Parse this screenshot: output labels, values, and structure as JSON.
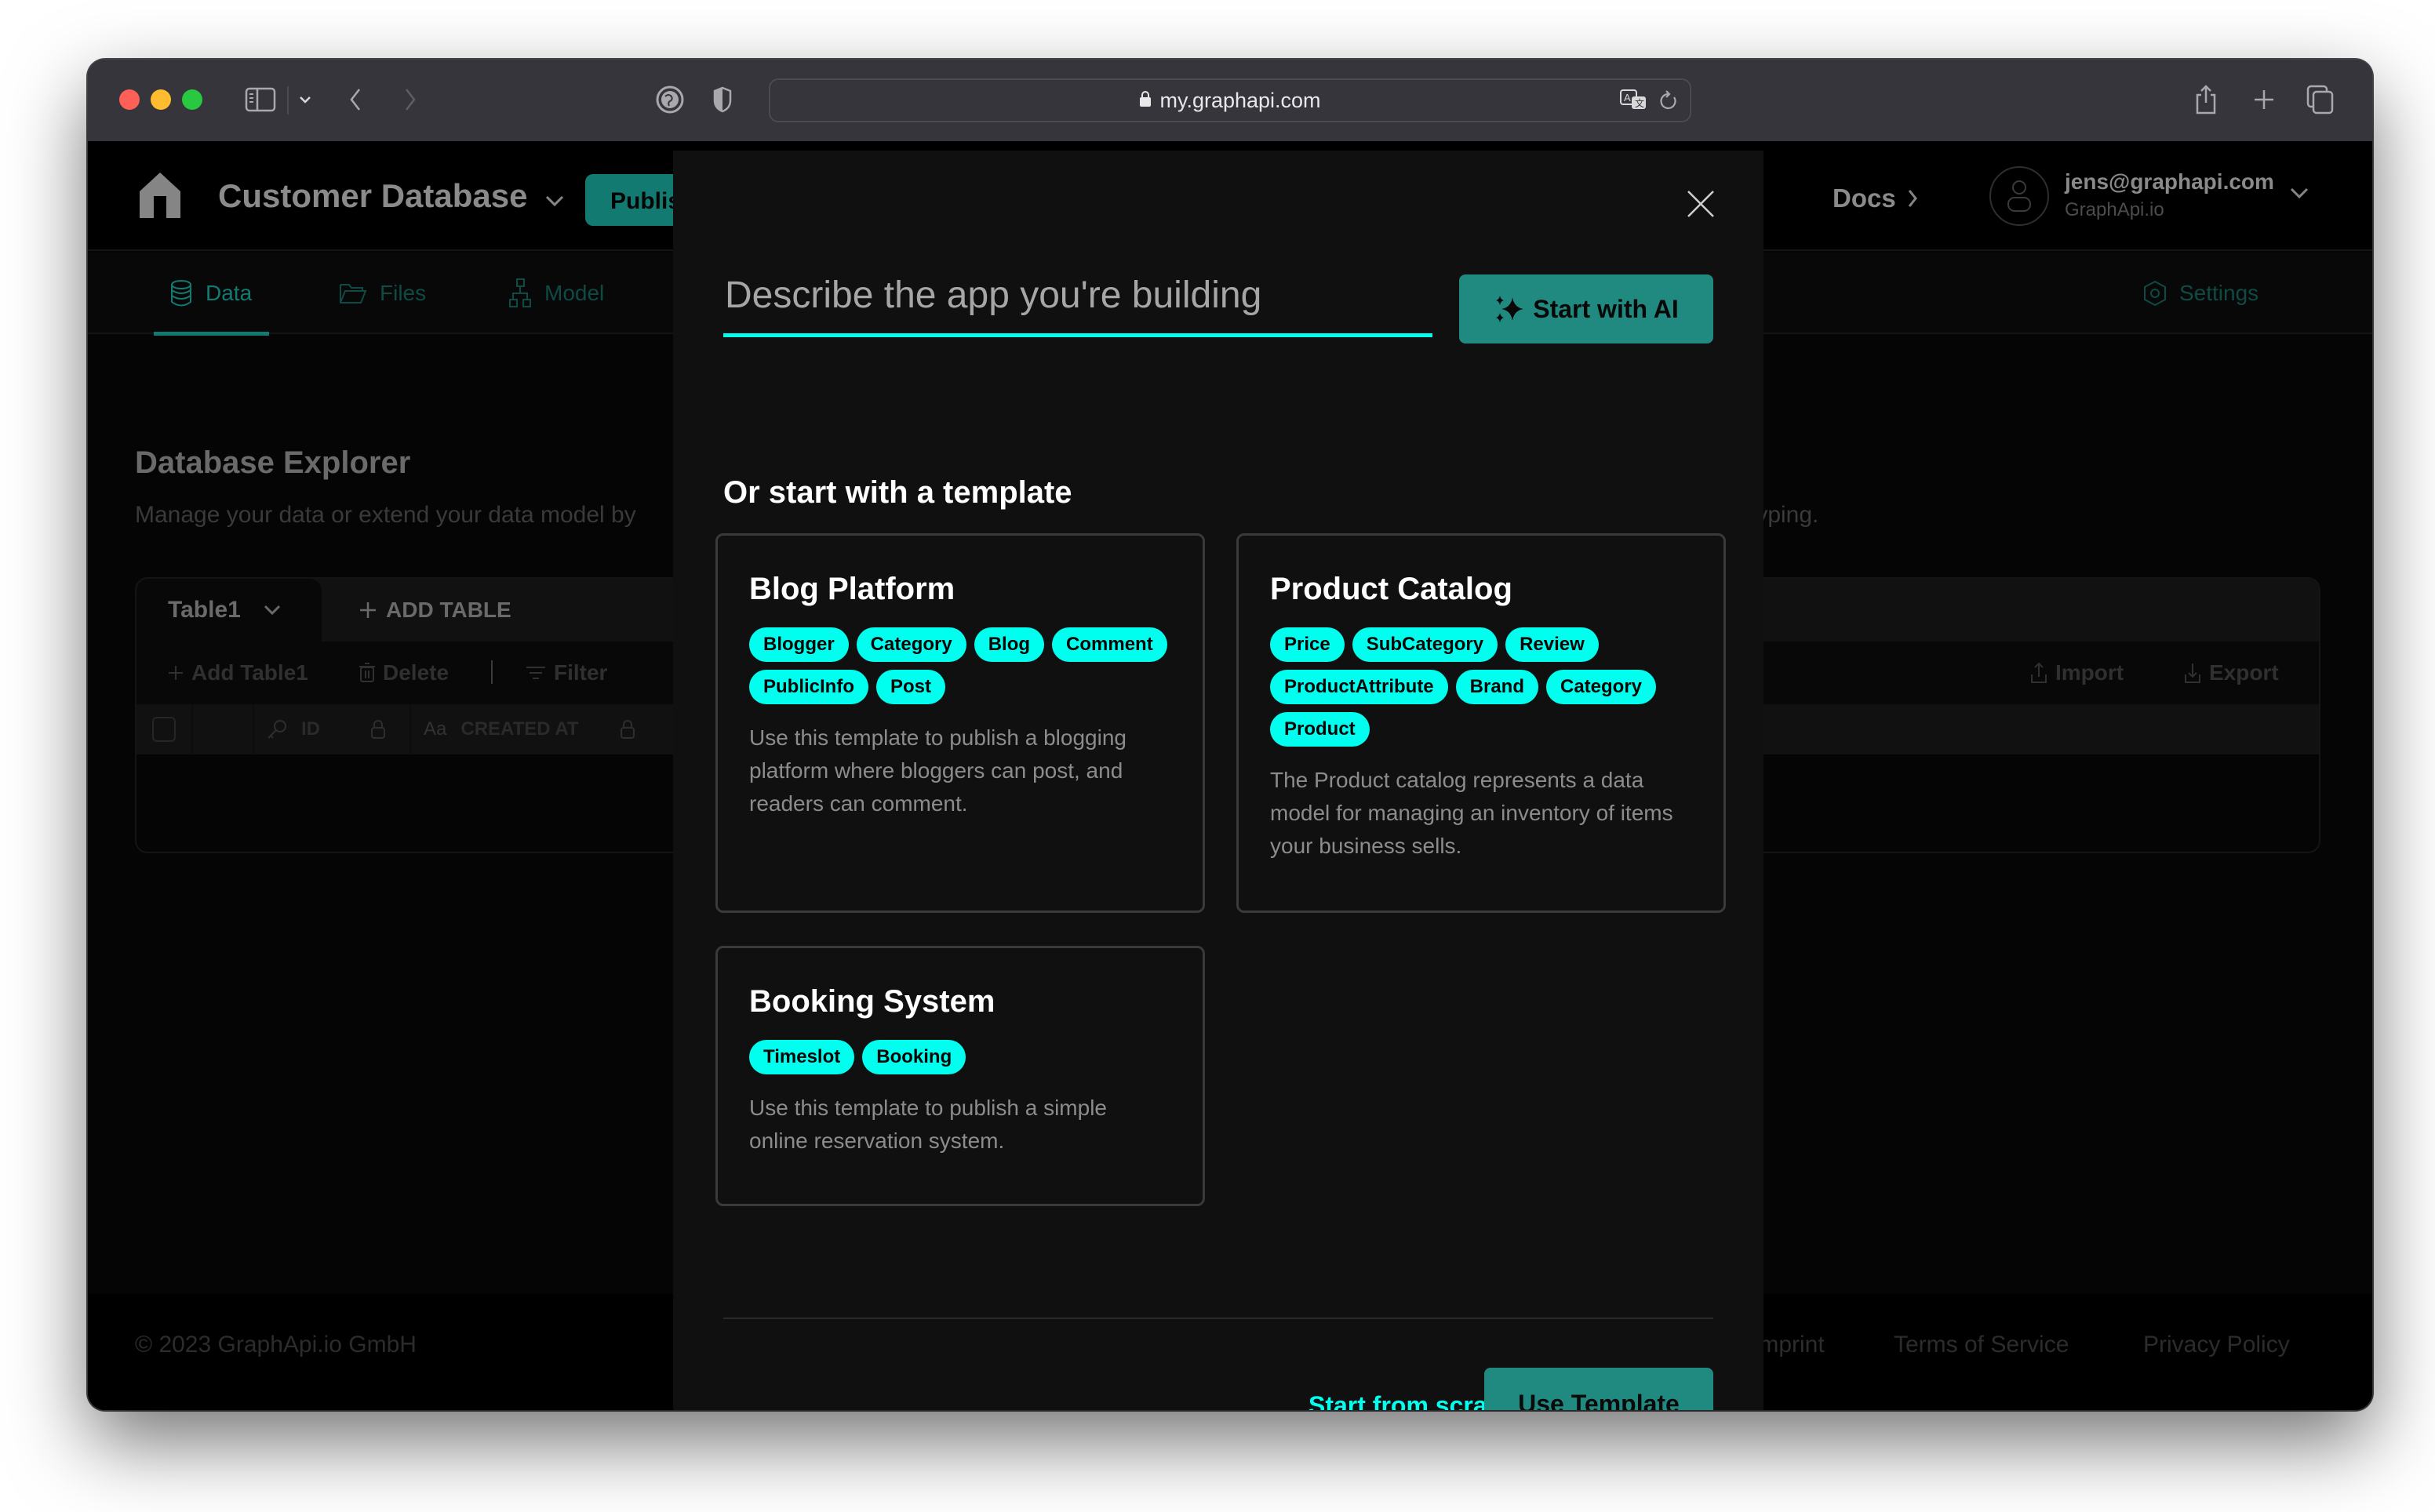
{
  "browser": {
    "url": "my.graphapi.com",
    "icons": [
      "sidebar-icon",
      "chevron-down-icon",
      "back-icon",
      "forward-icon",
      "privacy-report-icon",
      "shield-icon",
      "lock-icon",
      "translate-icon",
      "reload-icon",
      "share-icon",
      "new-tab-icon",
      "tab-overview-icon"
    ]
  },
  "header": {
    "project_name": "Customer Database",
    "publish_label": "Publish",
    "docs_label": "Docs",
    "user_email": "jens@graphapi.com",
    "user_org": "GraphApi.io"
  },
  "tabs": [
    {
      "label": "Data",
      "icon": "database-icon",
      "active": true
    },
    {
      "label": "Files",
      "icon": "folder-icon",
      "active": false
    },
    {
      "label": "Model",
      "icon": "hierarchy-icon",
      "active": false
    },
    {
      "label": "Settings",
      "icon": "settings-icon",
      "active": false
    }
  ],
  "explorer": {
    "title": "Database Explorer",
    "subtitle": "Manage your data or extend your data model by",
    "subtitle_tail": "typing.",
    "active_table": "Table1",
    "add_table_label": "ADD TABLE",
    "toolbar": {
      "add_row_label": "Add Table1",
      "delete_label": "Delete",
      "filter_label": "Filter",
      "import_label": "Import",
      "export_label": "Export"
    },
    "columns": [
      {
        "label": "ID",
        "type_icon": "key-icon",
        "locked": true
      },
      {
        "label": "CREATED AT",
        "type_icon": "text-type-icon",
        "type_text": "Aa",
        "locked": true
      }
    ]
  },
  "footer": {
    "copyright": "© 2023 GraphApi.io GmbH",
    "links": [
      "Imprint",
      "Terms of Service",
      "Privacy Policy"
    ]
  },
  "modal": {
    "ai_placeholder": "Describe the app you're building",
    "ai_value": "",
    "ai_button_label": "Start with AI",
    "section_title": "Or start with a template",
    "templates": [
      {
        "title": "Blog Platform",
        "tags": [
          "Blogger",
          "Category",
          "Blog",
          "Comment",
          "PublicInfo",
          "Post"
        ],
        "description": "Use this template to publish a blogging platform where bloggers can post, and readers can comment."
      },
      {
        "title": "Product Catalog",
        "tags": [
          "Price",
          "SubCategory",
          "Review",
          "ProductAttribute",
          "Brand",
          "Category",
          "Product"
        ],
        "description": "The Product catalog represents a data model for managing an inventory of items your business sells."
      },
      {
        "title": "Booking System",
        "tags": [
          "Timeslot",
          "Booking"
        ],
        "description": "Use this template to publish a simple online reservation system."
      }
    ],
    "scratch_label": "Start from scratch",
    "use_template_label": "Use Template"
  },
  "colors": {
    "accent": "#00ffee",
    "primary_button": "#218a80",
    "tab_active": "#137a71",
    "modal_bg": "#101010"
  }
}
